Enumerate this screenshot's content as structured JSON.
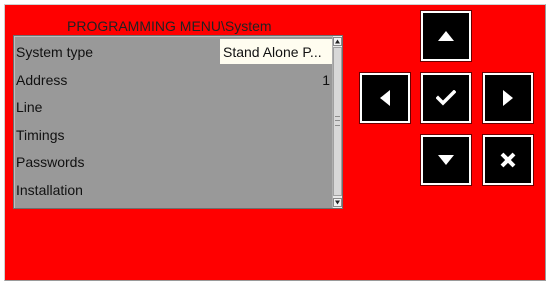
{
  "menu": {
    "title": "PROGRAMMING MENU\\System",
    "items": [
      {
        "label": "System type",
        "value": "Stand Alone P..."
      },
      {
        "label": "Address",
        "value": "1"
      },
      {
        "label": "Line",
        "value": ""
      },
      {
        "label": "Timings",
        "value": ""
      },
      {
        "label": "Passwords",
        "value": ""
      },
      {
        "label": "Installation",
        "value": ""
      }
    ]
  },
  "colors": {
    "panel_background": "#ff0000",
    "menu_background": "#999999",
    "selected_value_background": "#fffdf0",
    "button_background": "#000000",
    "button_border": "#ffffff"
  },
  "icons": {
    "scroll_up": "triangle-up-icon",
    "scroll_down": "triangle-down-icon",
    "up": "arrow-up-icon",
    "left": "arrow-left-icon",
    "ok": "checkmark-icon",
    "right": "arrow-right-icon",
    "down": "arrow-down-icon",
    "cancel": "cross-icon"
  }
}
